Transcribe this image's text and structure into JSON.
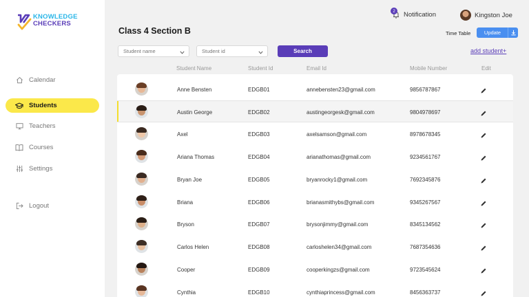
{
  "brand": {
    "line1": "KNOWLEDGE",
    "line2": "CHECKERS",
    "accent": "#5a3db8",
    "accent2": "#29b6e8"
  },
  "sidebar": {
    "items": [
      {
        "label": "Calendar",
        "icon": "home-icon"
      },
      {
        "label": "Students",
        "icon": "graduation-cap-icon",
        "active": true
      },
      {
        "label": "Teachers",
        "icon": "monitor-icon"
      },
      {
        "label": "Courses",
        "icon": "book-icon"
      },
      {
        "label": "Settings",
        "icon": "sliders-icon"
      },
      {
        "label": "Logout",
        "icon": "logout-icon"
      }
    ]
  },
  "header": {
    "notification_label": "Notification",
    "notification_count": "2",
    "user_name": "Kingston Joe",
    "page_title": "Class 4 Section B",
    "timetable_label": "Time Table",
    "update_label": "Update"
  },
  "filters": {
    "student_name_placeholder": "Student name",
    "student_id_placeholder": "Student id",
    "search_label": "Search",
    "add_student_label": "add student+"
  },
  "table": {
    "columns": [
      "Student Name",
      "Student Id",
      "Email Id",
      "Mobile Number",
      "Edit"
    ],
    "rows": [
      {
        "name": "Anne Bensten",
        "id": "EDGB01",
        "email": "annebensten23@gmail.com",
        "mobile": "9856787867"
      },
      {
        "name": "Austin George",
        "id": "EDGB02",
        "email": "austingeorgesk@gmail.com",
        "mobile": "9804978697",
        "selected": true
      },
      {
        "name": "Axel",
        "id": "EDGB03",
        "email": "axelsamson@gmail.com",
        "mobile": "8978678345"
      },
      {
        "name": "Ariana Thomas",
        "id": "EDGB04",
        "email": "arianathomas@gmail.com",
        "mobile": "9234561767"
      },
      {
        "name": "Bryan Joe",
        "id": "EDGB05",
        "email": "bryanrocky1@gmail.com",
        "mobile": "7692345876"
      },
      {
        "name": "Briana",
        "id": "EDGB06",
        "email": "brianasmithybs@gmail.com",
        "mobile": "9345267567"
      },
      {
        "name": "Bryson",
        "id": "EDGB07",
        "email": "brysonjimmy@gmail.com",
        "mobile": "8345134562"
      },
      {
        "name": "Carlos Helen",
        "id": "EDGB08",
        "email": "carloshelen34@gmail.com",
        "mobile": "7687354636"
      },
      {
        "name": "Cooper",
        "id": "EDGB09",
        "email": "cooperkingzs@gmail.com",
        "mobile": "9723545624"
      },
      {
        "name": "Cynthia",
        "id": "EDGB10",
        "email": "cynthiaprincess@gmail.com",
        "mobile": "8456363737"
      }
    ]
  }
}
